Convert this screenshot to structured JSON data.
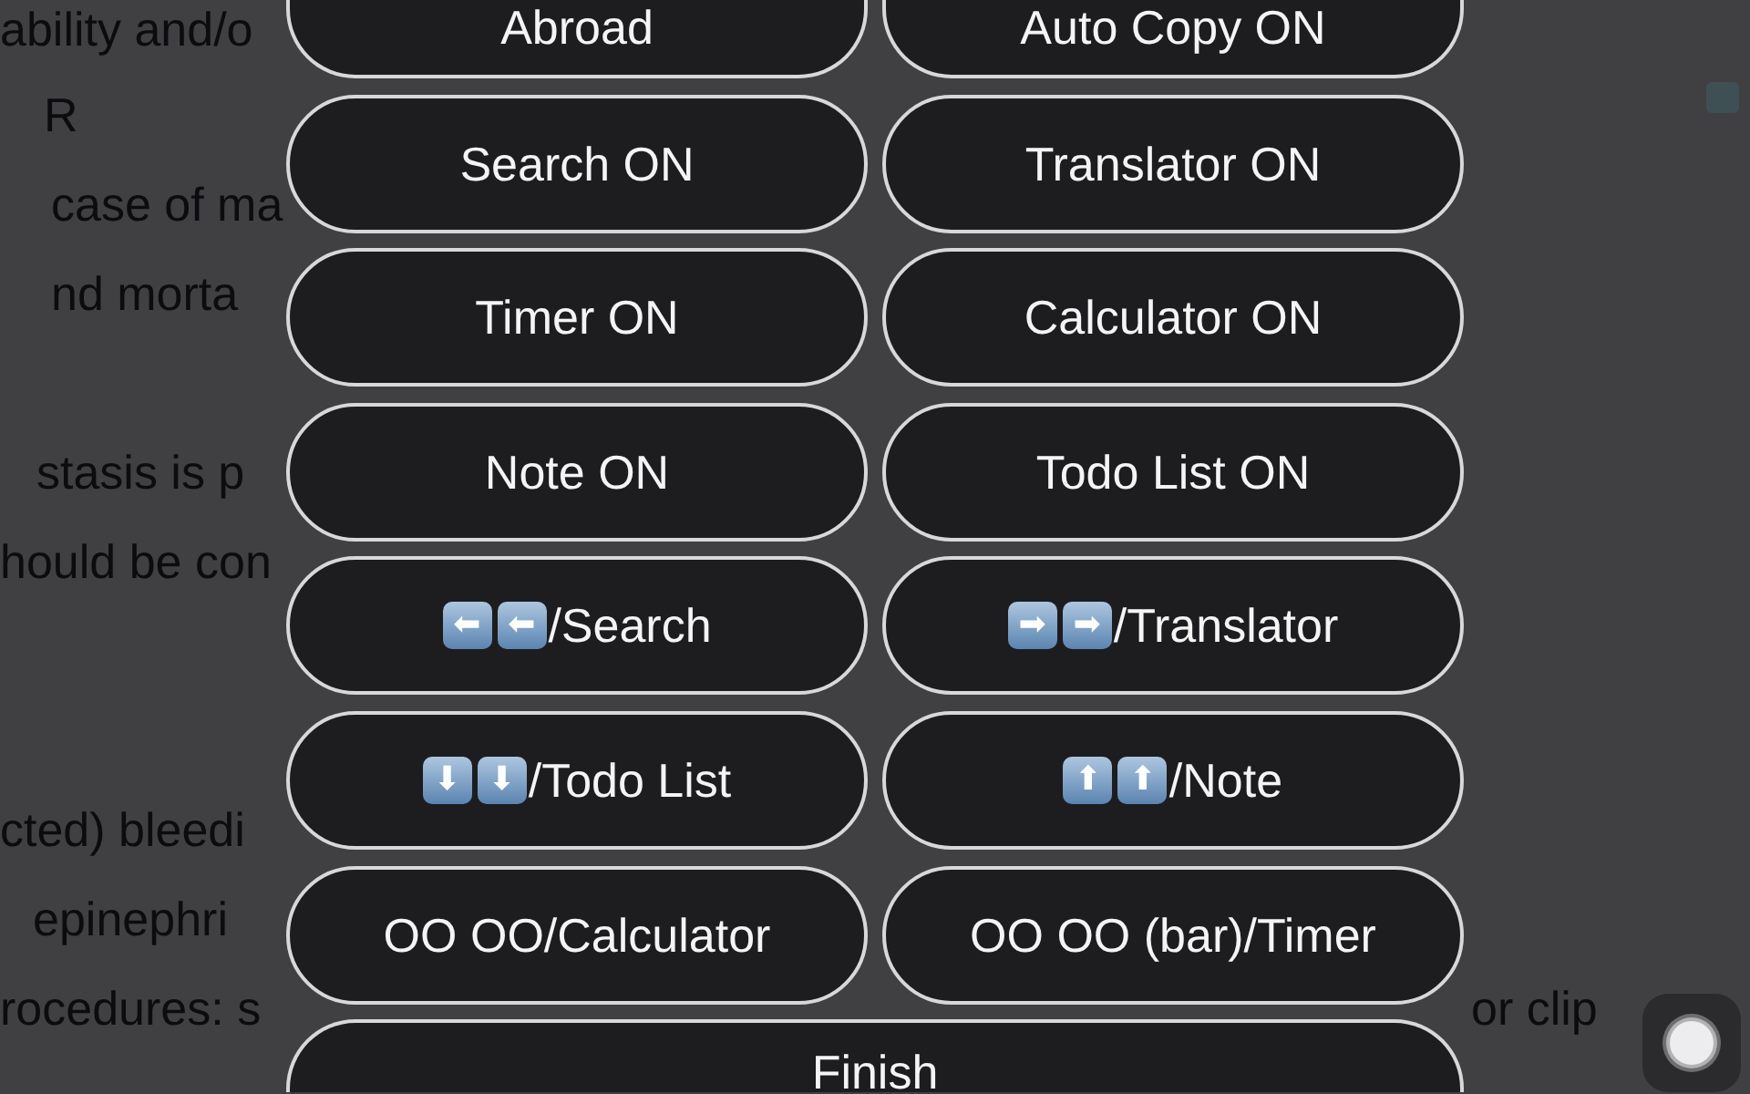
{
  "page_behind": {
    "left_column": [
      [
        "ability and/o",
        "R",
        "case of ma",
        "nd morta"
      ],
      [
        "stasis is p",
        "hould be con"
      ],
      [
        "cted) bleedi",
        "epinephri",
        "rocedures: s"
      ]
    ],
    "right_column": [
      "or clip"
    ]
  },
  "buttons": [
    {
      "kind": "plain",
      "label": "Abroad"
    },
    {
      "kind": "plain",
      "label": "Auto Copy ON"
    },
    {
      "kind": "plain",
      "label": "Search ON"
    },
    {
      "kind": "plain",
      "label": "Translator ON"
    },
    {
      "kind": "plain",
      "label": "Timer ON"
    },
    {
      "kind": "plain",
      "label": "Calculator ON"
    },
    {
      "kind": "plain",
      "label": "Note ON"
    },
    {
      "kind": "plain",
      "label": "Todo List ON"
    },
    {
      "kind": "shortcut",
      "keys": [
        "⬅",
        "⬅"
      ],
      "label": "/Search"
    },
    {
      "kind": "shortcut",
      "keys": [
        "➡",
        "➡"
      ],
      "label": "/Translator"
    },
    {
      "kind": "shortcut",
      "keys": [
        "⬇",
        "⬇"
      ],
      "label": "/Todo List"
    },
    {
      "kind": "shortcut",
      "keys": [
        "⬆",
        "⬆"
      ],
      "label": "/Note"
    },
    {
      "kind": "plain",
      "label": "OO OO/Calculator"
    },
    {
      "kind": "plain",
      "label": "OO OO (bar)/Timer"
    },
    {
      "kind": "wide",
      "label": "Finish"
    }
  ]
}
